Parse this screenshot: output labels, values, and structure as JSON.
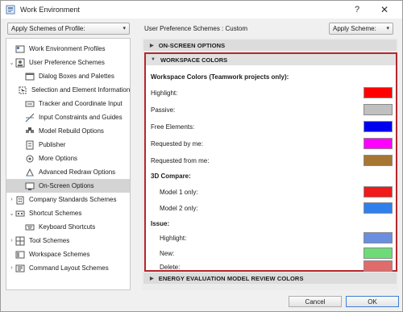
{
  "window": {
    "title": "Work Environment",
    "help_symbol": "?",
    "close_symbol": "✕"
  },
  "toolbar": {
    "profile_combo": "Apply Schemes of Profile:",
    "scheme_label": "User Preference Schemes : Custom",
    "scheme_combo": "Apply Scheme:"
  },
  "tree": {
    "items": [
      {
        "label": "Work Environment Profiles",
        "icon": "profiles-icon"
      },
      {
        "label": "User Preference Schemes",
        "icon": "preferences-icon"
      },
      {
        "label": "Dialog Boxes and Palettes",
        "icon": "dialog-icon"
      },
      {
        "label": "Selection and Element Information",
        "icon": "selection-icon"
      },
      {
        "label": "Tracker and Coordinate Input",
        "icon": "tracker-icon"
      },
      {
        "label": "Input Constraints and Guides",
        "icon": "constraints-icon"
      },
      {
        "label": "Model Rebuild Options",
        "icon": "rebuild-icon"
      },
      {
        "label": "Publisher",
        "icon": "publisher-icon"
      },
      {
        "label": "More Options",
        "icon": "more-options-icon"
      },
      {
        "label": "Advanced Redraw Options",
        "icon": "redraw-icon"
      },
      {
        "label": "On-Screen Options",
        "icon": "onscreen-icon"
      },
      {
        "label": "Company Standards Schemes",
        "icon": "company-icon"
      },
      {
        "label": "Shortcut Schemes",
        "icon": "shortcut-icon"
      },
      {
        "label": "Keyboard Shortcuts",
        "icon": "keyboard-icon"
      },
      {
        "label": "Tool Schemes",
        "icon": "tool-icon"
      },
      {
        "label": "Workspace Schemes",
        "icon": "workspace-icon"
      },
      {
        "label": "Command Layout Schemes",
        "icon": "command-icon"
      }
    ]
  },
  "sections": {
    "onscreen": "ON-SCREEN OPTIONS",
    "workspace": "WORKSPACE COLORS",
    "energy": "ENERGY EVALUATION MODEL REVIEW COLORS"
  },
  "workspace_colors": {
    "group_teamwork": "Workspace Colors (Teamwork projects only):",
    "highlight": {
      "label": "Highlight:",
      "color": "#ff0000"
    },
    "passive": {
      "label": "Passive:",
      "color": "#c0c0c0"
    },
    "free_elements": {
      "label": "Free Elements:",
      "color": "#0000ee"
    },
    "requested_by_me": {
      "label": "Requested by me:",
      "color": "#ff00ff"
    },
    "requested_from_me": {
      "label": "Requested from me:",
      "color": "#a67634"
    },
    "group_compare": "3D Compare:",
    "model1": {
      "label": "Model 1 only:",
      "color": "#f01a1a"
    },
    "model2": {
      "label": "Model 2 only:",
      "color": "#2f80ed"
    },
    "group_issue": "Issue:",
    "issue_highlight": {
      "label": "Highlight:",
      "color": "#6a8ee0"
    },
    "issue_new": {
      "label": "New:",
      "color": "#6ddc78"
    },
    "issue_delete": {
      "label": "Delete:",
      "color": "#e06b6b"
    }
  },
  "buttons": {
    "cancel": "Cancel",
    "ok": "OK"
  }
}
